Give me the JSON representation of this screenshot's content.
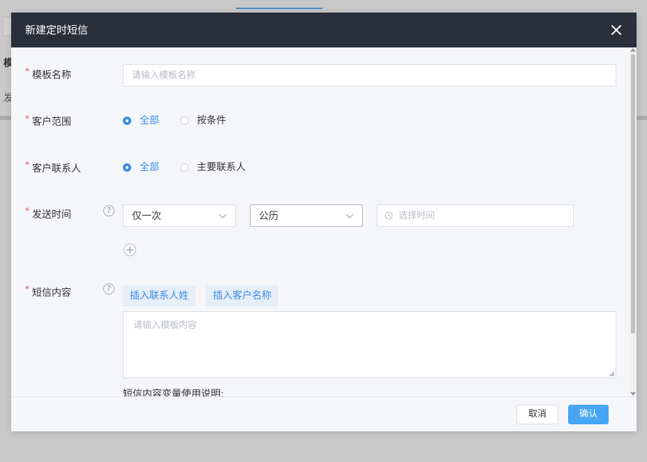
{
  "dialog": {
    "title": "新建定时短信"
  },
  "form": {
    "template_name": {
      "label": "模板名称",
      "placeholder": "请输入模板名称",
      "value": ""
    },
    "customer_scope": {
      "label": "客户范围",
      "options": [
        {
          "label": "全部",
          "checked": true
        },
        {
          "label": "按条件",
          "checked": false
        }
      ]
    },
    "customer_contact": {
      "label": "客户联系人",
      "options": [
        {
          "label": "全部",
          "checked": true
        },
        {
          "label": "主要联系人",
          "checked": false
        }
      ]
    },
    "send_time": {
      "label": "发送时间",
      "help": "?",
      "frequency_value": "仅一次",
      "calendar_value": "公历",
      "time_placeholder": "选择时间"
    },
    "sms_content": {
      "label": "短信内容",
      "help": "?",
      "insert_buttons": [
        "插入联系人姓",
        "插入客户名称"
      ],
      "placeholder": "请输入模板内容",
      "value": ""
    },
    "variable_hint": "短信内容变量使用说明:"
  },
  "footer": {
    "cancel_label": "取消",
    "confirm_label": "确认"
  },
  "background": {
    "text1": "模",
    "text2": "发"
  },
  "colors": {
    "header_bg": "#2b2f3b",
    "accent": "#3a8ee6",
    "confirm_bg": "#46a6f4",
    "required": "#e84a4a"
  }
}
